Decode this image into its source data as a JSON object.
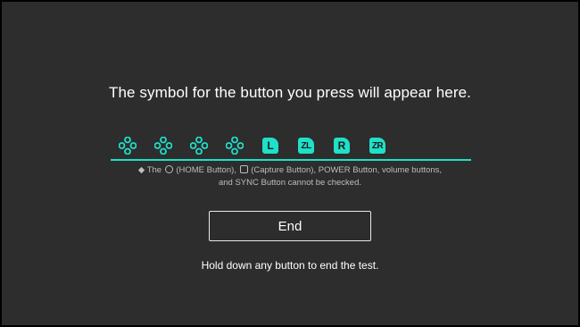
{
  "prompt": "The symbol for the button you press will appear here.",
  "button_icons": [
    {
      "icon": "dpad-icon"
    },
    {
      "icon": "dpad-icon"
    },
    {
      "icon": "dpad-icon"
    },
    {
      "icon": "dpad-icon"
    },
    {
      "icon": "l-button-icon",
      "label": "L"
    },
    {
      "icon": "zl-button-icon",
      "label": "ZL"
    },
    {
      "icon": "r-button-icon",
      "label": "R"
    },
    {
      "icon": "zr-button-icon",
      "label": "ZR"
    }
  ],
  "note": {
    "bullet": "◆",
    "part1": "The",
    "home": "(HOME Button),",
    "capture": "(Capture Button), POWER Button, volume buttons,",
    "line2": "and SYNC Button cannot be checked."
  },
  "end_button": "End",
  "hold_text": "Hold down any button to end the test.",
  "colors": {
    "accent": "#1fe0c8",
    "background": "#2d2d2d",
    "frame": "#000000",
    "text": "#ffffff"
  }
}
